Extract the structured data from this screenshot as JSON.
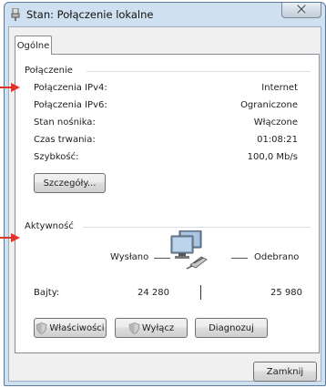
{
  "window": {
    "title": "Stan: Połączenie lokalne"
  },
  "tabs": [
    {
      "label": "Ogólne"
    }
  ],
  "connection": {
    "group_title": "Połączenie",
    "rows": [
      {
        "label": "Połączenia IPv4:",
        "value": "Internet"
      },
      {
        "label": "Połączenia IPv6:",
        "value": "Ograniczone"
      },
      {
        "label": "Stan nośnika:",
        "value": "Włączone"
      },
      {
        "label": "Czas trwania:",
        "value": "01:08:21"
      },
      {
        "label": "Szybkość:",
        "value": "100,0 Mb/s"
      }
    ],
    "details_button": "Szczegóły..."
  },
  "activity": {
    "group_title": "Aktywność",
    "sent_label": "Wysłano",
    "received_label": "Odebrano",
    "bytes_label": "Bajty:",
    "bytes_sent": "24 280",
    "bytes_received": "25 980"
  },
  "buttons": {
    "properties": "Właściwości",
    "disable": "Wyłącz",
    "diagnose": "Diagnozuj",
    "close": "Zamknij"
  },
  "colors": {
    "annotation_arrow": "#e0332b",
    "window_frame": "#cfe0f1"
  },
  "icons": {
    "title": "network-adapter-icon",
    "close": "close-x-icon",
    "shield": "uac-shield-icon",
    "activity": "network-computers-icon"
  }
}
